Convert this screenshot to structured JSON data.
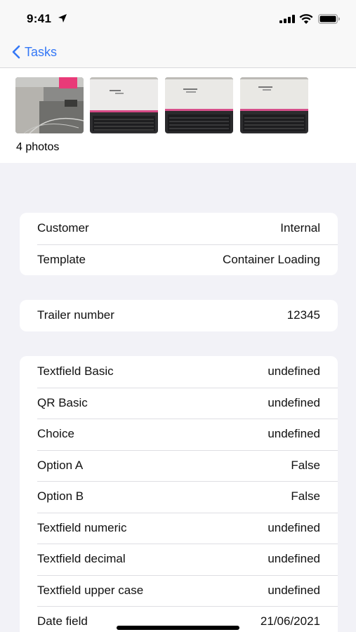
{
  "status": {
    "time": "9:41"
  },
  "nav": {
    "back_label": "Tasks"
  },
  "photos": {
    "count_label": "4 photos"
  },
  "summary": [
    {
      "label": "Customer",
      "value": "Internal"
    },
    {
      "label": "Template",
      "value": "Container Loading"
    }
  ],
  "trailer": [
    {
      "label": "Trailer number",
      "value": "12345"
    }
  ],
  "fields": [
    {
      "label": "Textfield Basic",
      "value": "undefined"
    },
    {
      "label": "QR Basic",
      "value": "undefined"
    },
    {
      "label": "Choice",
      "value": "undefined"
    },
    {
      "label": "Option A",
      "value": "False"
    },
    {
      "label": "Option B",
      "value": "False"
    },
    {
      "label": "Textfield numeric",
      "value": "undefined"
    },
    {
      "label": "Textfield decimal",
      "value": "undefined"
    },
    {
      "label": "Textfield upper case",
      "value": "undefined"
    },
    {
      "label": "Date field",
      "value": "21/06/2021"
    }
  ],
  "colors": {
    "accent": "#3478f6",
    "background": "#f2f2f7"
  }
}
